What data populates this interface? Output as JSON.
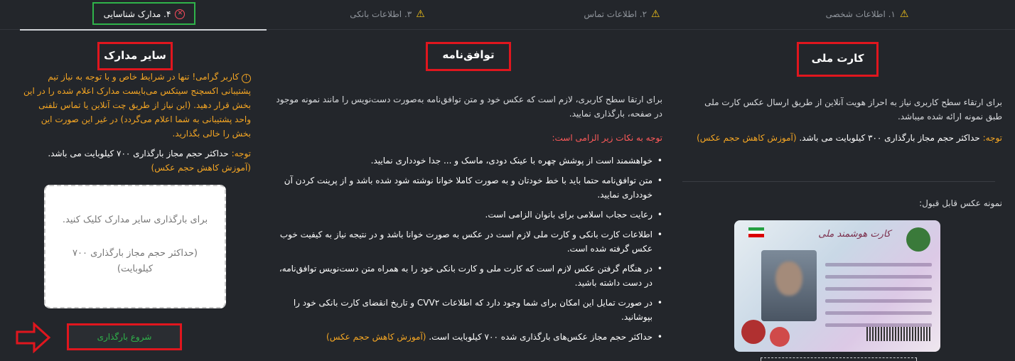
{
  "tabs": [
    {
      "label": "۱. اطلاعات شخصی",
      "status": "warning"
    },
    {
      "label": "۲. اطلاعات تماس",
      "status": "warning"
    },
    {
      "label": "۳. اطلاعات بانکی",
      "status": "warning"
    },
    {
      "label": "۴. مدارک شناسایی",
      "status": "error",
      "active": true
    }
  ],
  "national_card": {
    "title": "کارت ملی",
    "description": "برای ارتقاء سطح کاربری نیاز به احراز هویت آنلاین از طریق ارسال عکس کارت ملی طبق نمونه ارائه شده میباشد.",
    "note_label": "توجه:",
    "note_text": "حداکثر حجم مجاز بارگذاری ۳۰۰ کیلوبایت می باشد.",
    "note_link": "(آموزش کاهش حجم عکس)",
    "sample_label": "نمونه عکس قابل قبول:",
    "card_title": "کارت هوشمند ملی"
  },
  "agreement": {
    "title": "توافق‌نامه",
    "description": "برای ارتقا سطح کاربری، لازم است که عکس خود و متن توافق‌نامه به‌صورت دست‌نویس را مانند نمونه موجود در صفحه، بارگذاری نمایید.",
    "rules_heading": "توجه به نکات زیر الزامی است:",
    "rules": [
      "خواهشمند است از پوشش چهره با عینک دودی، ماسک و ... جدا خودداری نمایید.",
      "متن توافق‌نامه حتما باید با خط خودتان و به صورت کاملا خوانا نوشته شود شده باشد و از پرینت کردن آن خودداری نمایید.",
      "رعایت حجاب اسلامی برای بانوان الزامی است.",
      "اطلاعات کارت بانکی و کارت ملی لازم است در عکس به صورت خوانا باشد و در نتیجه نیاز به کیفیت خوب عکس گرفته شده است.",
      "در هنگام گرفتن عکس لازم است که کارت ملی و کارت بانکی خود را به همراه متن دست‌نویس توافق‌نامه، در دست داشته باشید.",
      "در صورت تمایل این امکان برای شما وجود دارد که اطلاعات CVV۲ و تاریخ انقضای کارت بانکی خود را بپوشانید."
    ],
    "last_rule": "حداکثر حجم مجاز عکس‌های بارگذاری شده ۷۰۰ کیلوبایت است.",
    "last_rule_link": "(آموزش کاهش حجم عکس)"
  },
  "other_docs": {
    "title": "سایر مدارک",
    "info_icon": "info-circle-icon",
    "warning_text": "کاربر گرامی! تنها در شرایط خاص و با توجه به نیاز تیم پشتیبانی اکسچنج سیتکس می‌بایست مدارک اعلام شده را در این بخش قرار دهید. (این نیاز از طریق چت آنلاین یا تماس تلفنی واحد پشتیبانی به شما اعلام می‌گردد) در غیر این صورت این بخش را خالی بگذارید.",
    "note_label": "توجه:",
    "note_text": "حداکثر حجم مجاز بارگذاری ۷۰۰ کیلوبایت می باشد.",
    "note_link": "(آموزش کاهش حجم عکس)",
    "upload_text": "برای بارگذاری سایر مدارک کلیک کنید.",
    "upload_limit": "(حداکثر حجم مجاز بارگذاری ۷۰۰ کیلوبایت)",
    "start_button": "شروع بارگذاری"
  },
  "colors": {
    "background": "#23262b",
    "accent_orange": "#f5a623",
    "warning_yellow": "#f5c518",
    "error_red": "#ff4d5e",
    "success_green": "#2fb34a",
    "highlight_red": "#e0161e"
  }
}
